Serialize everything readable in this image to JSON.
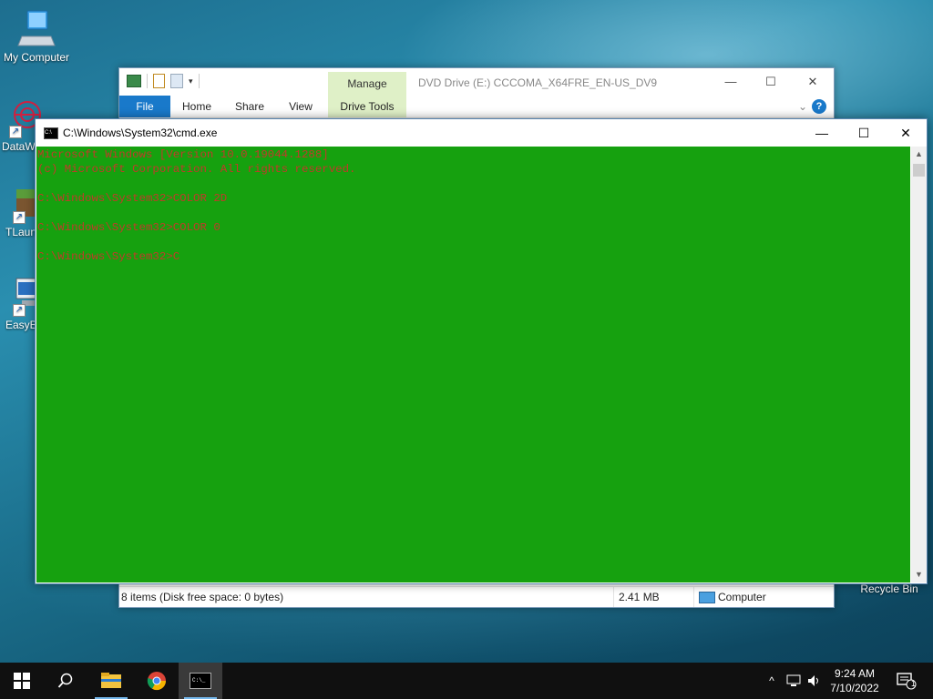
{
  "desktop": {
    "icons": [
      {
        "label": "My Computer"
      },
      {
        "label": "DataW"
      },
      {
        "label": "TLaun"
      },
      {
        "label": "EasyB"
      }
    ],
    "recycle_bin": "Recycle Bin"
  },
  "explorer": {
    "title": "DVD Drive (E:) CCCOMA_X64FRE_EN-US_DV9",
    "context_tab": "Manage",
    "tabs": [
      "File",
      "Home",
      "Share",
      "View",
      "Drive Tools"
    ],
    "status_items": "8 items (Disk free space: 0 bytes)",
    "status_size": "2.41 MB",
    "status_location": "Computer"
  },
  "cmd": {
    "title": "C:\\Windows\\System32\\cmd.exe",
    "lines": [
      "Microsoft Windows [Version 10.0.19044.1288]",
      "(c) Microsoft Corporation. All rights reserved.",
      "",
      "C:\\Windows\\System32>COLOR 2D",
      "",
      "C:\\Windows\\System32>COLOR 0",
      "",
      "C:\\Windows\\System32>C"
    ],
    "colors": {
      "background": "#16a10f",
      "text": "#c13a2a"
    }
  },
  "taskbar": {
    "apps": [
      "start-icon",
      "search-icon",
      "file-explorer-icon",
      "chrome-icon",
      "cmd-icon"
    ],
    "clock_time": "9:24 AM",
    "clock_date": "7/10/2022",
    "notification_count": "1"
  }
}
